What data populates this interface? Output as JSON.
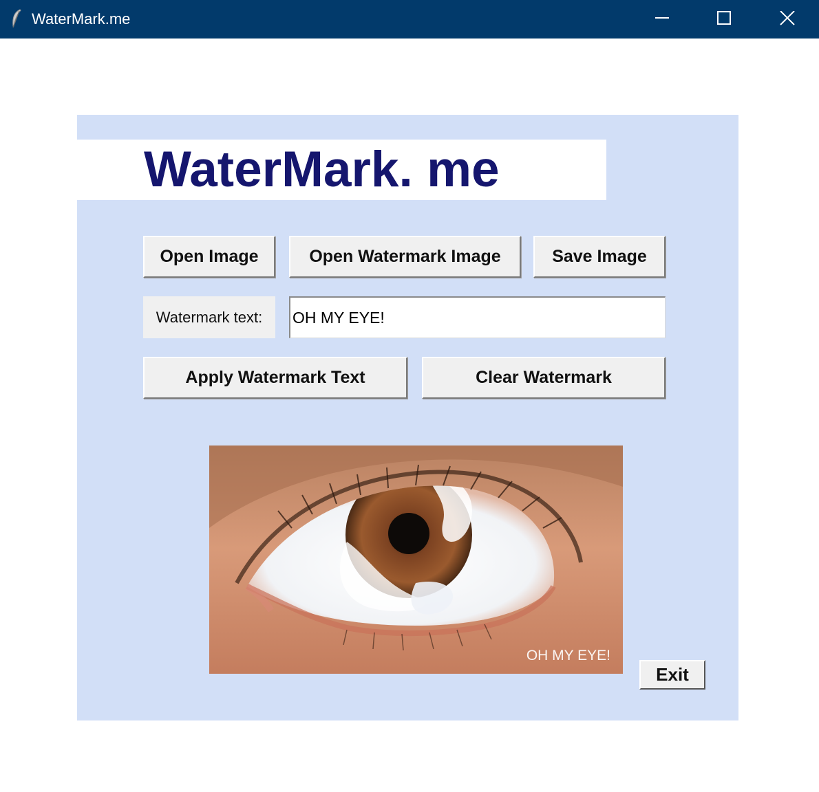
{
  "window": {
    "title": "WaterMark.me",
    "icon": "feather-icon",
    "controls": [
      "minimize-icon",
      "maximize-icon",
      "close-icon"
    ],
    "titlebar_color": "#023a6b"
  },
  "app": {
    "logo_text": "WaterMark. me",
    "logo_color": "#15166e",
    "panel_color": "#d2dff7",
    "buttons": {
      "open_image": "Open Image",
      "open_watermark_image": "Open Watermark Image",
      "save_image": "Save Image",
      "apply_watermark_text": "Apply Watermark Text",
      "clear_watermark": "Clear Watermark",
      "exit": "Exit"
    },
    "watermark_label": "Watermark text:",
    "watermark_value": "OH MY EYE!",
    "preview_watermark": "OH MY EYE!"
  }
}
